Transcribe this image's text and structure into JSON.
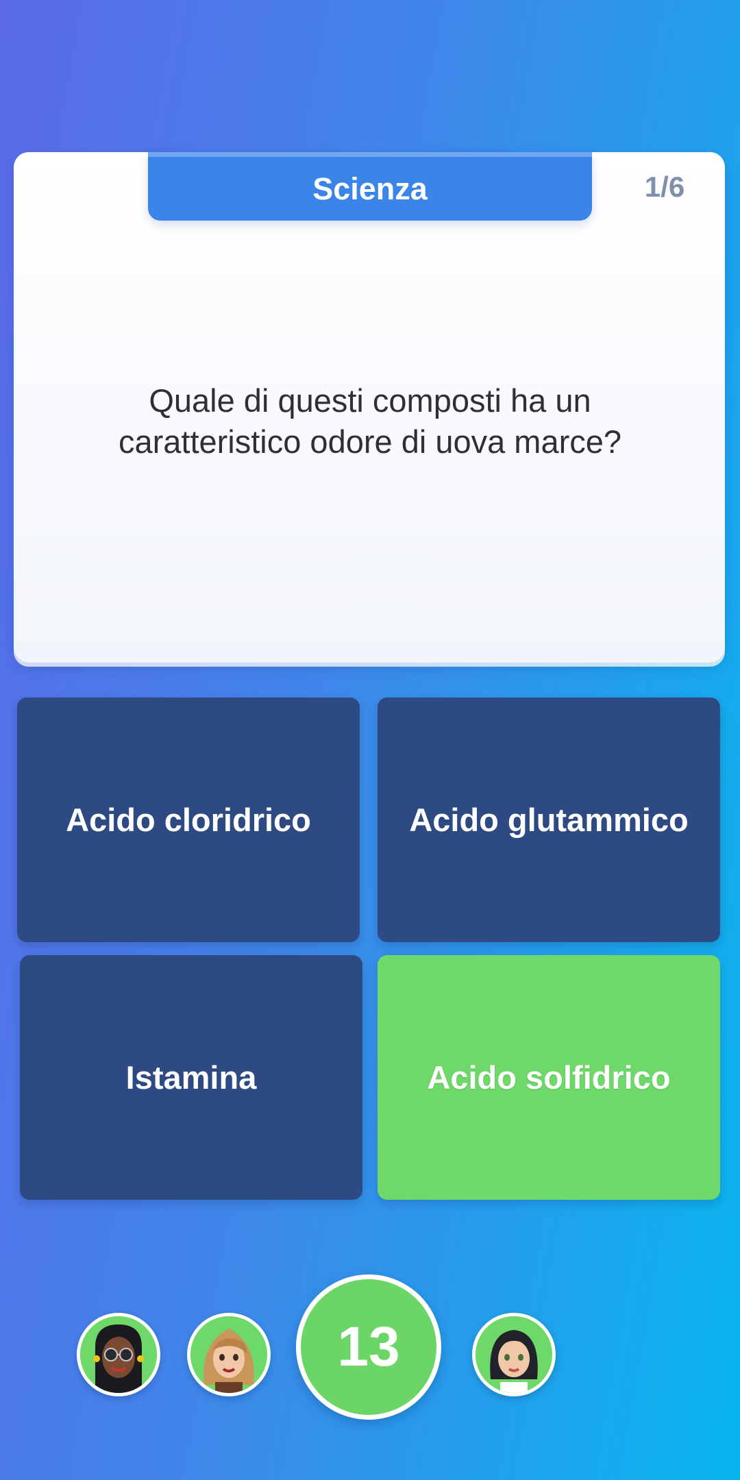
{
  "quiz": {
    "category": "Scienza",
    "progress": "1/6",
    "question": "Quale di questi composti ha un caratteristico odore di uova marce?"
  },
  "answers": [
    {
      "label": "Acido cloridrico",
      "state": "default"
    },
    {
      "label": "Acido glutammico",
      "state": "default"
    },
    {
      "label": "Istamina",
      "state": "default"
    },
    {
      "label": "Acido solfidrico",
      "state": "correct"
    }
  ],
  "players": [
    {
      "avatar": "avatar-woman-sunglasses-braids"
    },
    {
      "avatar": "avatar-woman-blonde"
    },
    {
      "avatar": "avatar-woman-dark-hair"
    }
  ],
  "timer": {
    "value": "13"
  },
  "colors": {
    "answer_default": "#2d4a83",
    "answer_correct": "#6ed968",
    "category_tab": "#3b84e8",
    "timer": "#6bd666"
  }
}
